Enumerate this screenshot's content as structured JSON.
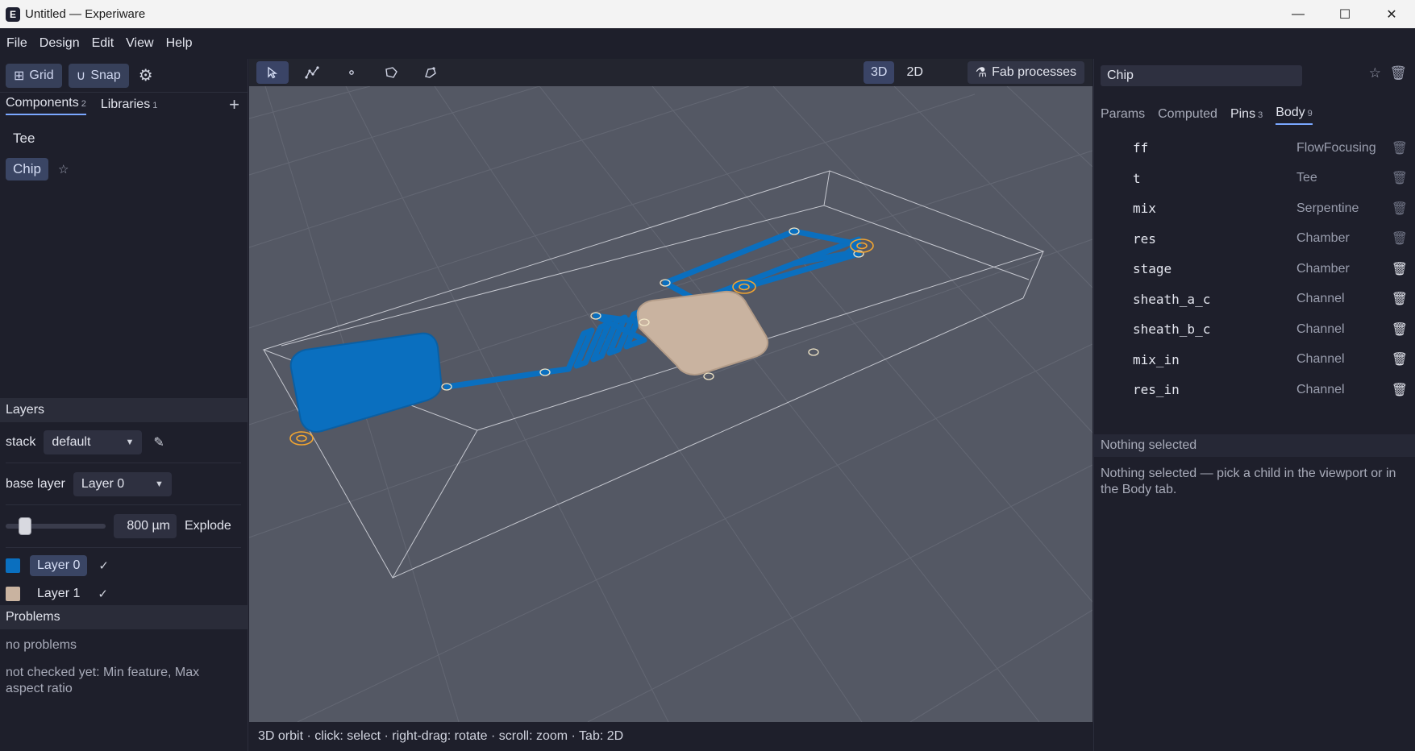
{
  "window": {
    "title": "Untitled — Experiware",
    "app_icon_letter": "E"
  },
  "menu": [
    "File",
    "Design",
    "Edit",
    "View",
    "Help"
  ],
  "left_toolbar": {
    "grid_label": "Grid",
    "snap_label": "Snap"
  },
  "left_tabs": [
    {
      "label": "Components",
      "count": "2"
    },
    {
      "label": "Libraries",
      "count": "1"
    }
  ],
  "components": [
    {
      "name": "Tee",
      "selected": false
    },
    {
      "name": "Chip",
      "selected": true
    }
  ],
  "layers": {
    "title": "Layers",
    "stack_label": "stack",
    "stack_value": "default",
    "base_layer_label": "base layer",
    "base_layer_value": "Layer 0",
    "explode_value": "800 µm",
    "explode_label": "Explode",
    "explode_fraction": 0.15,
    "items": [
      {
        "name": "Layer 0",
        "color": "#0a6fbf",
        "visible": "✓"
      },
      {
        "name": "Layer 1",
        "color": "#c9b3a0",
        "visible": "✓"
      }
    ]
  },
  "problems": {
    "title": "Problems",
    "status": "no problems",
    "note": "not checked yet: Min feature, Max aspect ratio"
  },
  "viewport": {
    "mode_3d": "3D",
    "mode_2d": "2D",
    "fab_label": "Fab processes",
    "status": "3D orbit · click: select · right-drag: rotate · scroll: zoom · Tab: 2D",
    "colors": {
      "layer0": "#0a6fbf",
      "layer1": "#c9b3a0",
      "port": "#f2a531",
      "background": "#545864"
    }
  },
  "inspector": {
    "name_value": "Chip",
    "tabs": [
      {
        "label": "Params",
        "count": ""
      },
      {
        "label": "Computed",
        "count": ""
      },
      {
        "label": "Pins",
        "count": "3"
      },
      {
        "label": "Body",
        "count": "9"
      }
    ],
    "body_items": [
      {
        "name": "ff",
        "type": "FlowFocusing",
        "deletable": false
      },
      {
        "name": "t",
        "type": "Tee",
        "deletable": false
      },
      {
        "name": "mix",
        "type": "Serpentine",
        "deletable": false
      },
      {
        "name": "res",
        "type": "Chamber",
        "deletable": false
      },
      {
        "name": "stage",
        "type": "Chamber",
        "deletable": true
      },
      {
        "name": "sheath_a_c",
        "type": "Channel",
        "deletable": true
      },
      {
        "name": "sheath_b_c",
        "type": "Channel",
        "deletable": true
      },
      {
        "name": "mix_in",
        "type": "Channel",
        "deletable": true
      },
      {
        "name": "res_in",
        "type": "Channel",
        "deletable": true
      }
    ],
    "selection_header": "Nothing selected",
    "selection_text": "Nothing selected — pick a child in the viewport or in the Body tab."
  }
}
